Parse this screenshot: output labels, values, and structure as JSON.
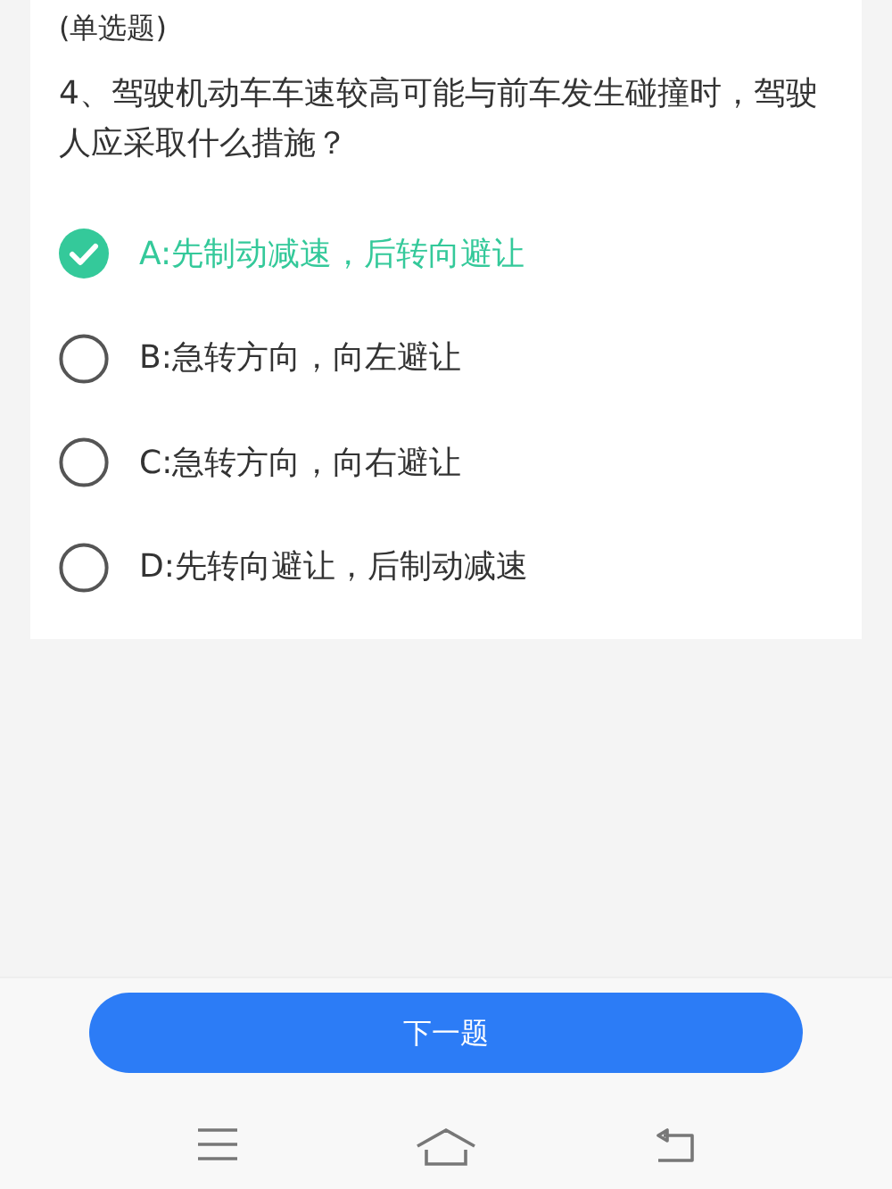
{
  "question": {
    "type_label": "(单选题)",
    "text": "4、驾驶机动车车速较高可能与前车发生碰撞时，驾驶人应采取什么措施？"
  },
  "options": [
    {
      "label": "A:先制动减速，后转向避让",
      "selected": true
    },
    {
      "label": "B:急转方向，向左避让",
      "selected": false
    },
    {
      "label": "C:急转方向，向右避让",
      "selected": false
    },
    {
      "label": "D:先转向避让，后制动减速",
      "selected": false
    }
  ],
  "next_button": {
    "label": "下一题"
  }
}
